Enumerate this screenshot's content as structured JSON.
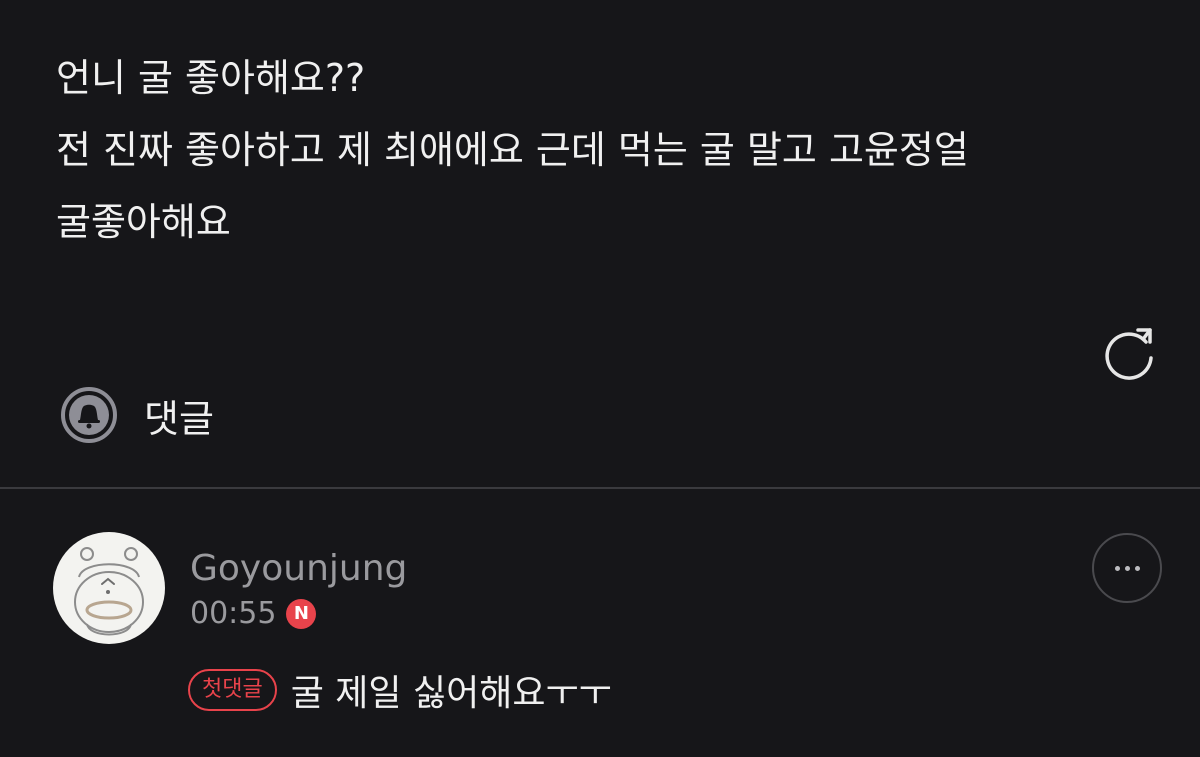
{
  "post": {
    "lines": [
      "언니 굴 좋아해요??",
      "전 진짜 좋아하고 제 최애에요 근데 먹는 굴 말고 고윤정얼",
      "굴좋아해요"
    ]
  },
  "comments_section": {
    "title": "댓글",
    "icon": "bell-icon"
  },
  "refresh": {
    "icon": "refresh-icon"
  },
  "comment": {
    "author": "Goyounjung",
    "time": "00:55",
    "new_badge": "N",
    "first_comment_badge": "첫댓글",
    "text": "굴 제일 싫어해요ㅜㅜ",
    "more_icon": "more-icon"
  },
  "colors": {
    "background": "#161619",
    "accent_red": "#e8434b",
    "muted_text": "#9a9a9e"
  }
}
